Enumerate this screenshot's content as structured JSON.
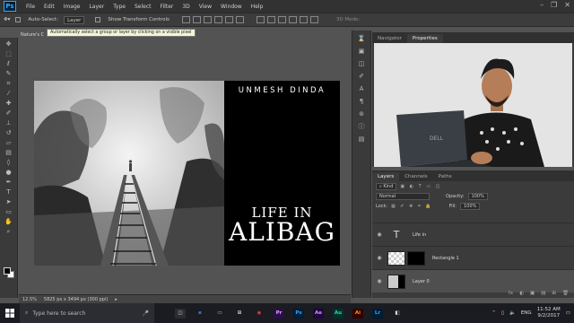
{
  "app": {
    "logo": "Ps",
    "window_controls": [
      "–",
      "❐",
      "✕"
    ]
  },
  "menu": [
    "File",
    "Edit",
    "Image",
    "Layer",
    "Type",
    "Select",
    "Filter",
    "3D",
    "View",
    "Window",
    "Help"
  ],
  "options_bar": {
    "auto_select_label": "Auto-Select:",
    "auto_select_value": "Layer",
    "show_transform_label": "Show Transform Controls",
    "mode_3d_label": "3D Mode:"
  },
  "tooltip": "Automatically select a group or layer by clicking on a visible pixel",
  "document": {
    "tab_title": "Nature's C",
    "zoom": "12.5%",
    "doc_info": "5825 px x 3494 px (300 ppi)"
  },
  "artwork": {
    "author": "UNMESH DINDA",
    "title_line1": "LIFE IN",
    "title_line2": "ALIBAG"
  },
  "tools_icons": [
    "move-icon",
    "marquee-icon",
    "lasso-icon",
    "quick-select-icon",
    "crop-icon",
    "eyedropper-icon",
    "healing-icon",
    "brush-icon",
    "stamp-icon",
    "history-brush-icon",
    "eraser-icon",
    "gradient-icon",
    "blur-icon",
    "dodge-icon",
    "pen-icon",
    "type-icon",
    "path-select-icon",
    "shape-icon",
    "hand-icon",
    "zoom-icon"
  ],
  "navigator_panel": {
    "tabs": [
      "Navigator",
      "Properties"
    ],
    "active_tab": "Properties"
  },
  "layers_panel": {
    "tabs": [
      "Layers",
      "Channels",
      "Paths"
    ],
    "filter_label": "Kind",
    "blend_mode": "Normal",
    "opacity_label": "Opacity:",
    "opacity_value": "100%",
    "lock_label": "Lock:",
    "fill_label": "Fill:",
    "fill_value": "100%",
    "layers": [
      {
        "name": "Life in",
        "type": "text"
      },
      {
        "name": "Rectangle 1",
        "type": "shape"
      },
      {
        "name": "Layer 0",
        "type": "image"
      }
    ],
    "footer_icons": [
      "fx",
      "◐",
      "▣",
      "▤",
      "⊞",
      "🗑"
    ]
  },
  "taskbar": {
    "search_placeholder": "Type here to search",
    "apps": [
      {
        "label": "◫",
        "color": "#2b2b33",
        "fg": "#ddd"
      },
      {
        "label": "e",
        "color": "#1b1b22",
        "fg": "#3a8ee6"
      },
      {
        "label": "▭",
        "color": "#1b1b22",
        "fg": "#e8c46a"
      },
      {
        "label": "⊞",
        "color": "#1b1b22",
        "fg": "#ddd"
      },
      {
        "label": "◉",
        "color": "#1b1b22",
        "fg": "#e94335"
      },
      {
        "label": "Pr",
        "color": "#2a0f4a",
        "fg": "#e0a3ff"
      },
      {
        "label": "Ps",
        "color": "#001e36",
        "fg": "#31a8ff"
      },
      {
        "label": "Ae",
        "color": "#1f0740",
        "fg": "#d291ff"
      },
      {
        "label": "Au",
        "color": "#00322b",
        "fg": "#39d6a7"
      },
      {
        "label": "Ai",
        "color": "#330000",
        "fg": "#ff9a00"
      },
      {
        "label": "Lr",
        "color": "#001d34",
        "fg": "#31a8ff"
      },
      {
        "label": "◧",
        "color": "#1b1b22",
        "fg": "#ddd"
      }
    ],
    "time": "11:52 AM",
    "date": "9/2/2017",
    "lang": "ENG"
  }
}
